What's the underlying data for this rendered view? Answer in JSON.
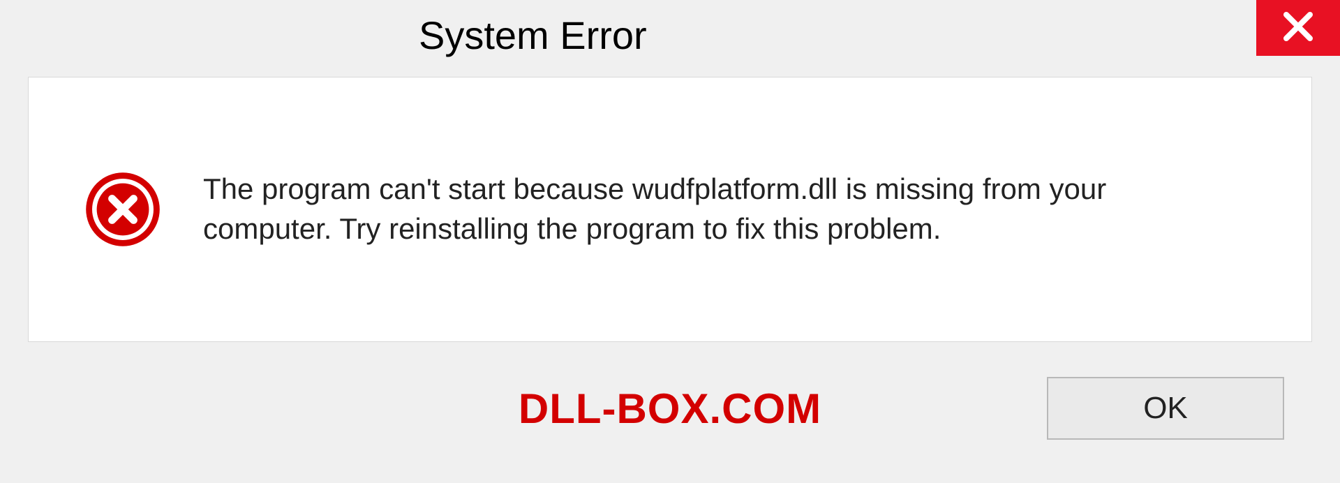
{
  "dialog": {
    "title": "System Error",
    "message": "The program can't start because wudfplatform.dll is missing from your computer. Try reinstalling the program to fix this problem.",
    "ok_label": "OK"
  },
  "watermark": "DLL-BOX.COM"
}
